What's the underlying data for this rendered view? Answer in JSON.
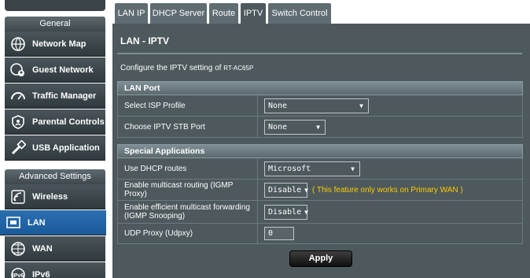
{
  "sidebar": {
    "general_header": "General",
    "advanced_header": "Advanced Settings",
    "general_items": [
      {
        "label": "Network Map",
        "icon": "network-map-icon"
      },
      {
        "label": "Guest Network",
        "icon": "guest-network-icon"
      },
      {
        "label": "Traffic Manager",
        "icon": "traffic-manager-icon"
      },
      {
        "label": "Parental Controls",
        "icon": "parental-controls-icon"
      },
      {
        "label": "USB Application",
        "icon": "usb-application-icon"
      }
    ],
    "advanced_items": [
      {
        "label": "Wireless",
        "icon": "wireless-icon"
      },
      {
        "label": "LAN",
        "icon": "lan-icon",
        "active": true
      },
      {
        "label": "WAN",
        "icon": "wan-icon"
      },
      {
        "label": "IPv6",
        "icon": "ipv6-icon"
      }
    ]
  },
  "tabs": [
    {
      "label": "LAN IP"
    },
    {
      "label": "DHCP Server"
    },
    {
      "label": "Route"
    },
    {
      "label": "IPTV",
      "active": true
    },
    {
      "label": "Switch Control"
    }
  ],
  "page": {
    "title": "LAN - IPTV",
    "description": "Configure the IPTV setting of",
    "model": "RT-AC65P"
  },
  "lan_port": {
    "header": "LAN Port",
    "isp_profile_label": "Select ISP Profile",
    "isp_profile_value": "None",
    "stb_port_label": "Choose IPTV STB Port",
    "stb_port_value": "None"
  },
  "special": {
    "header": "Special Applications",
    "dhcp_routes_label": "Use DHCP routes",
    "dhcp_routes_value": "Microsoft",
    "igmp_proxy_label": "Enable multicast routing (IGMP Proxy)",
    "igmp_proxy_value": "Disable",
    "igmp_proxy_note": "( This feature only works on Primary WAN )",
    "igmp_snooping_label": "Enable efficient multicast forwarding (IGMP Snooping)",
    "igmp_snooping_value": "Disable",
    "udpxy_label": "UDP Proxy (Udpxy)",
    "udpxy_value": "0"
  },
  "apply_label": "Apply",
  "colors": {
    "panel": "#4d595d",
    "active_nav": "#1a5a9b",
    "note": "#ffcc00"
  }
}
